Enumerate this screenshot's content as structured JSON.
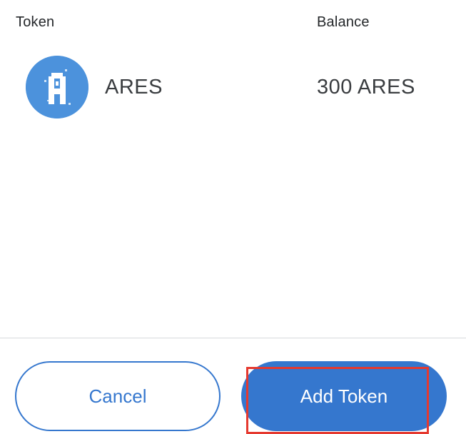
{
  "table": {
    "header_token": "Token",
    "header_balance": "Balance"
  },
  "token": {
    "icon": "ares-token-icon",
    "name": "ARES",
    "balance": "300 ARES"
  },
  "actions": {
    "cancel_label": "Cancel",
    "add_label": "Add Token"
  },
  "colors": {
    "primary": "#3577ce",
    "avatar": "#4c92dc",
    "highlight": "#e5392f",
    "divider": "#d6d9dc"
  }
}
